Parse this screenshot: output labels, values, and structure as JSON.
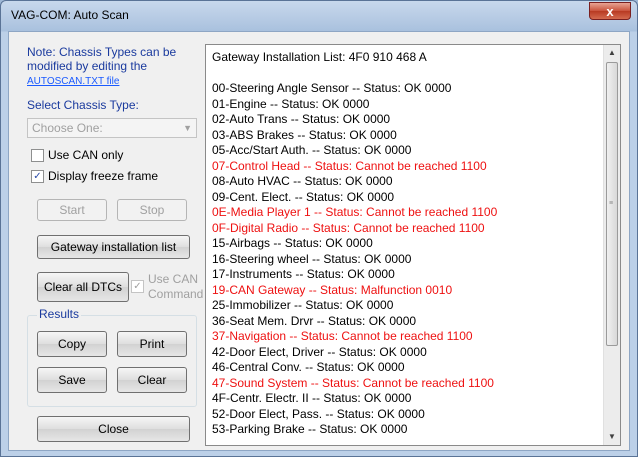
{
  "window": {
    "title": "VAG-COM: Auto Scan",
    "close_glyph": "x"
  },
  "note": {
    "text": "Note:  Chassis Types can be modified by editing the",
    "link": "AUTOSCAN.TXT file"
  },
  "chassis": {
    "label": "Select Chassis Type:",
    "value": "Choose One:"
  },
  "options": {
    "use_can_only": "Use CAN only",
    "display_freeze_frame": "Display freeze frame"
  },
  "buttons": {
    "start": "Start",
    "stop": "Stop",
    "gateway": "Gateway installation list",
    "clear_dtcs": "Clear all DTCs",
    "copy": "Copy",
    "print": "Print",
    "save": "Save",
    "clear": "Clear",
    "close": "Close"
  },
  "use_can_command": {
    "line1": "Use CAN",
    "line2": "Command"
  },
  "results_label": "Results",
  "colors": {
    "error": "#ee1111",
    "label_blue": "#1a3a9e"
  },
  "log": {
    "lines": [
      {
        "text": "Gateway Installation List:  4F0 910 468 A",
        "error": false
      },
      {
        "text": "",
        "error": false
      },
      {
        "text": "00-Steering Angle Sensor -- Status: OK 0000",
        "error": false
      },
      {
        "text": "01-Engine -- Status: OK 0000",
        "error": false
      },
      {
        "text": "02-Auto Trans -- Status: OK 0000",
        "error": false
      },
      {
        "text": "03-ABS Brakes -- Status: OK 0000",
        "error": false
      },
      {
        "text": "05-Acc/Start Auth. -- Status: OK 0000",
        "error": false
      },
      {
        "text": "07-Control Head -- Status: Cannot be reached 1100",
        "error": true
      },
      {
        "text": "08-Auto HVAC -- Status: OK 0000",
        "error": false
      },
      {
        "text": "09-Cent. Elect. -- Status: OK 0000",
        "error": false
      },
      {
        "text": "0E-Media Player 1 -- Status: Cannot be reached 1100",
        "error": true
      },
      {
        "text": "0F-Digital Radio -- Status: Cannot be reached 1100",
        "error": true
      },
      {
        "text": "15-Airbags -- Status: OK 0000",
        "error": false
      },
      {
        "text": "16-Steering wheel -- Status: OK 0000",
        "error": false
      },
      {
        "text": "17-Instruments -- Status: OK 0000",
        "error": false
      },
      {
        "text": "19-CAN Gateway -- Status: Malfunction 0010",
        "error": true
      },
      {
        "text": "25-Immobilizer -- Status: OK 0000",
        "error": false
      },
      {
        "text": "36-Seat Mem. Drvr -- Status: OK 0000",
        "error": false
      },
      {
        "text": "37-Navigation -- Status: Cannot be reached 1100",
        "error": true
      },
      {
        "text": "42-Door Elect, Driver -- Status: OK 0000",
        "error": false
      },
      {
        "text": "46-Central Conv. -- Status: OK 0000",
        "error": false
      },
      {
        "text": "47-Sound System -- Status: Cannot be reached 1100",
        "error": true
      },
      {
        "text": "4F-Centr. Electr. II -- Status: OK 0000",
        "error": false
      },
      {
        "text": "52-Door Elect, Pass. -- Status: OK 0000",
        "error": false
      },
      {
        "text": "53-Parking Brake -- Status: OK 0000",
        "error": false
      }
    ]
  }
}
